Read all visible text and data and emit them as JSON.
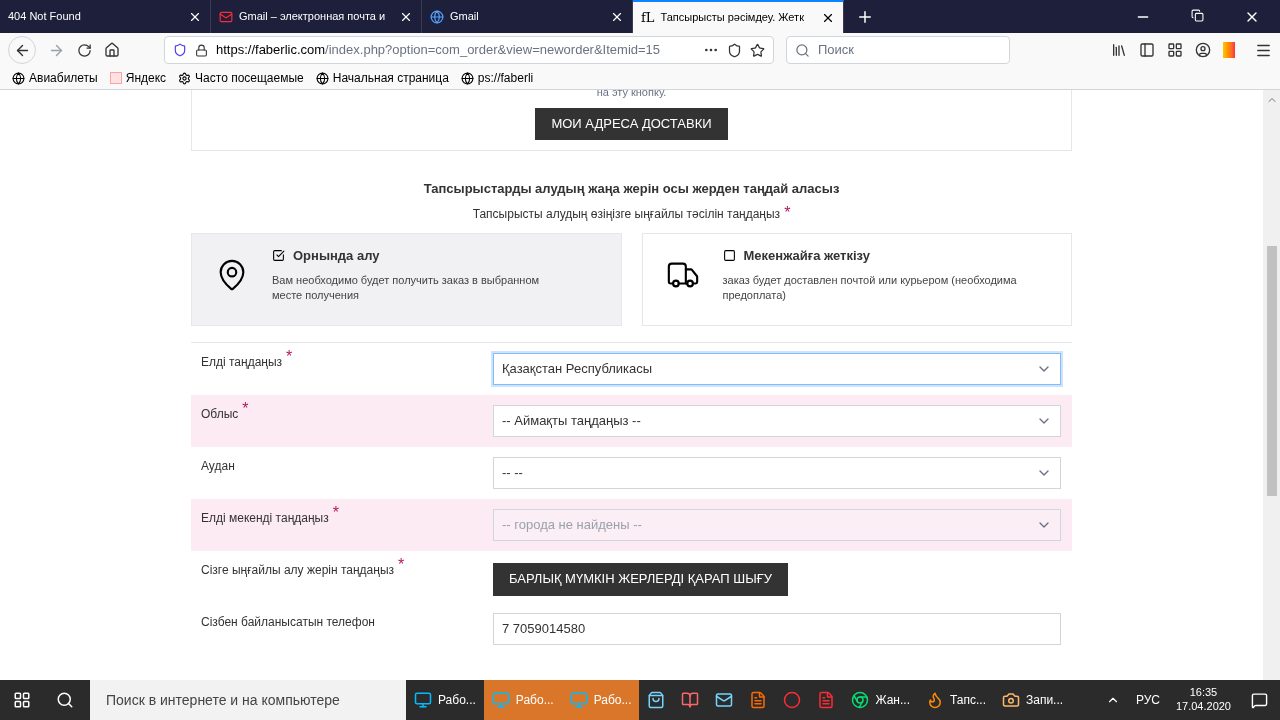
{
  "tabs": [
    {
      "title": "404 Not Found",
      "selected": false
    },
    {
      "title": "Gmail – электронная почта и",
      "selected": false
    },
    {
      "title": "Gmail",
      "selected": false
    },
    {
      "title": "Тапсырысты рәсімдеу. Жетк",
      "selected": true
    }
  ],
  "favicon_text": "fL",
  "url": {
    "domain": "https://faberlic.com",
    "path": "/index.php?option=com_order&view=neworder&Itemid=15"
  },
  "search": {
    "placeholder": "Поиск"
  },
  "bookmarks": [
    {
      "label": "Авиабилеты"
    },
    {
      "label": "Яндекс"
    },
    {
      "label": "Часто посещаемые"
    },
    {
      "label": "Начальная страница"
    },
    {
      "label": "ps://faberli"
    }
  ],
  "top_note": "на эту кнопку.",
  "addresses_button": "МОИ АДРЕСА ДОСТАВКИ",
  "heading": "Тапсырыстарды алудың жаңа жерін осы жерден таңдай аласыз",
  "subheading": "Тапсырысты алудың өзіңізге ыңғайлы тәсілін таңдаңыз",
  "required_mark": "*",
  "methods": [
    {
      "kind": "pickup",
      "title": "Орнында алу",
      "description": "Вам необходимо будет получить заказ в выбранном месте получения",
      "checked": true
    },
    {
      "kind": "delivery",
      "title": "Мекенжайға жеткізу",
      "description": "заказ будет доставлен почтой или курьером (необходима предоплата)",
      "checked": false
    }
  ],
  "fields": [
    {
      "kind": "select",
      "label": "Елді таңдаңыз",
      "required": true,
      "value": "Қазақстан Республикасы",
      "focused": true,
      "disabled": false
    },
    {
      "kind": "select",
      "label": "Облыс",
      "required": true,
      "value": "-- Аймақты таңдаңыз --",
      "focused": false,
      "disabled": false
    },
    {
      "kind": "select",
      "label": "Аудан",
      "required": false,
      "value": "-- --",
      "focused": false,
      "disabled": false
    },
    {
      "kind": "select",
      "label": "Елді мекенді таңдаңыз",
      "required": true,
      "value": "-- города не найдены --",
      "focused": false,
      "disabled": true
    },
    {
      "kind": "button",
      "label": "Сізге ыңғайлы алу жерін таңдаңыз",
      "required": true,
      "value": "БАРЛЫҚ МҮМКІН ЖЕРЛЕРДІ ҚАРАП ШЫҒУ"
    },
    {
      "kind": "input",
      "label": "Сізбен байланысатын телефон",
      "required": false,
      "value": "7 7059014580"
    }
  ],
  "taskbar": {
    "search_placeholder": "Поиск в интернете и на компьютере",
    "apps": [
      {
        "label": "Рабо...",
        "selected": false
      },
      {
        "label": "Рабо...",
        "selected": true
      },
      {
        "label": "Рабо...",
        "selected": true
      },
      {
        "selected": false
      },
      {
        "selected": false
      },
      {
        "selected": false
      },
      {
        "selected": false
      },
      {
        "selected": false
      },
      {
        "selected": false
      },
      {
        "label": "Жан...",
        "selected": false
      },
      {
        "label": "Тапс...",
        "selected": false
      },
      {
        "label": "Запи...",
        "selected": false
      }
    ],
    "language": "РУС",
    "time": "16:35",
    "date": "17.04.2020"
  }
}
